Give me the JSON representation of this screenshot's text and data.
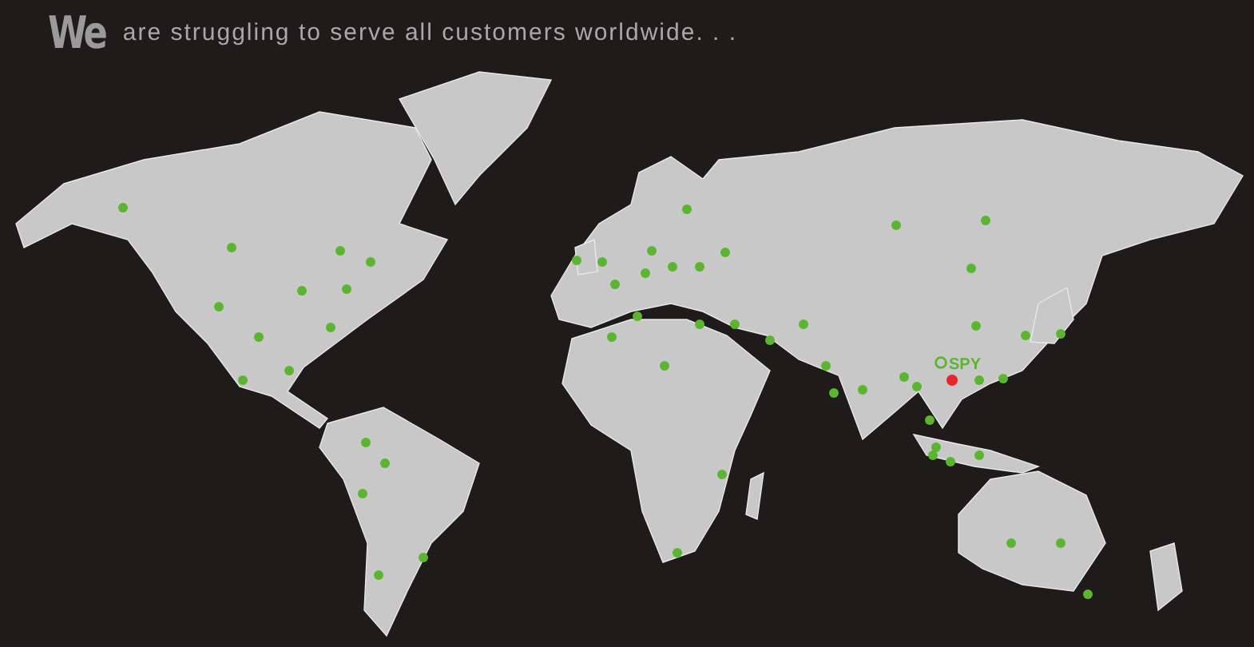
{
  "title": {
    "lead": "We",
    "rest": "are struggling to serve all customers worldwide. . ."
  },
  "markers": [
    {
      "kind": "customer",
      "color": "#5cb531"
    },
    {
      "kind": "headquarters",
      "color": "#e8262a",
      "label": "SPY"
    }
  ]
}
